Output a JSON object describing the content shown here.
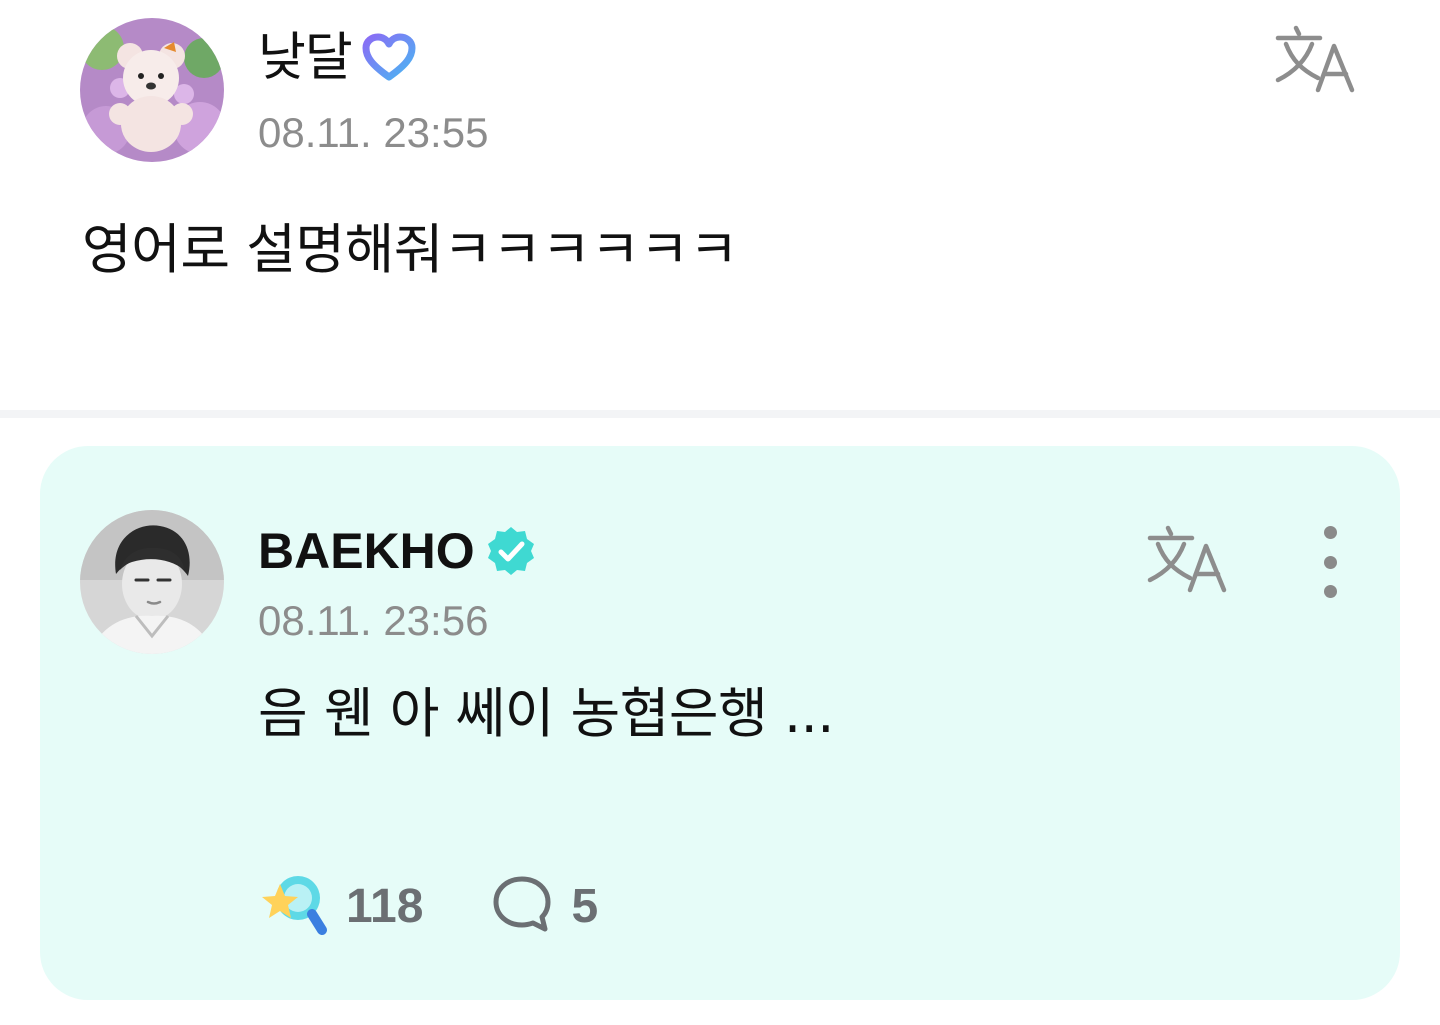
{
  "post": {
    "author": "낮달",
    "timestamp": "08.11. 23:55",
    "body": "영어로 설명해줘ㅋㅋㅋㅋㅋㅋ",
    "avatar_icon": "teddy-bear-avatar",
    "badge_icon": "fan-membership-heart-icon",
    "translate_icon": "translate-icon"
  },
  "reply": {
    "author": "BAEKHO",
    "timestamp": "08.11. 23:56",
    "body": "음 웬 아 쎄이 농협은행 ...",
    "avatar_icon": "artist-portrait-avatar",
    "badge_icon": "verified-badge-icon",
    "translate_icon": "translate-icon",
    "more_icon": "more-vertical-icon",
    "reactions": {
      "count": "118",
      "icon": "star-search-reaction-icon"
    },
    "comments": {
      "count": "5",
      "icon": "comment-bubble-icon"
    },
    "card_color": "#e6fcf8",
    "accent_color": "#3fd9d2"
  }
}
